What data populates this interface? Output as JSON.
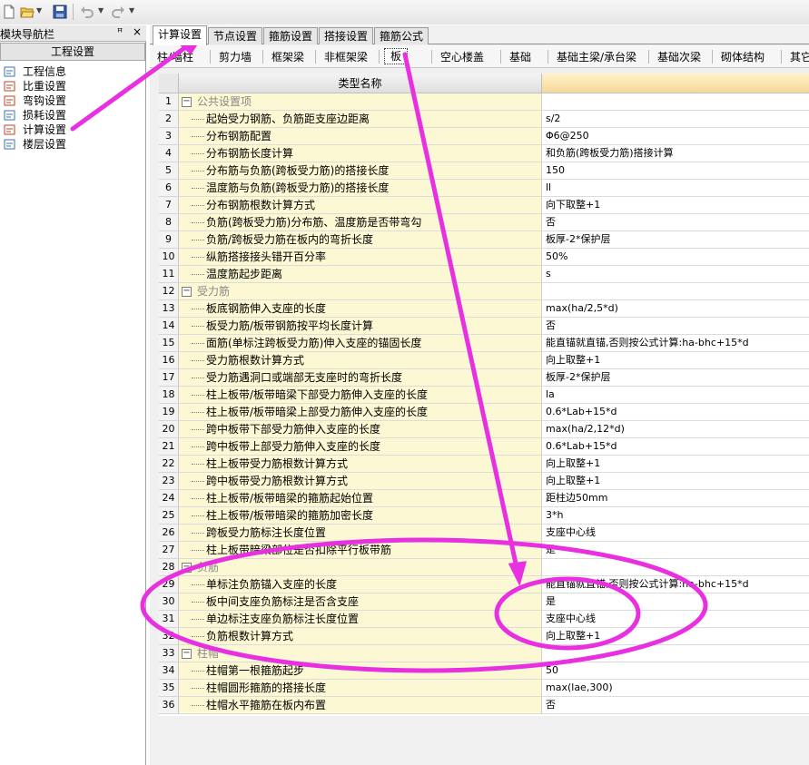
{
  "toolbar": {
    "icons": [
      "new-file-icon",
      "open-folder-icon",
      "save-icon",
      "undo-icon",
      "redo-icon"
    ]
  },
  "nav": {
    "title": "模块导航栏",
    "pin": "ꟸ",
    "close": "×",
    "section": "工程设置",
    "items": [
      {
        "label": "工程信息",
        "icon": "project-info-icon",
        "color": "#3a6fb0"
      },
      {
        "label": "比重设置",
        "icon": "weight-settings-icon",
        "color": "#c04020"
      },
      {
        "label": "弯钩设置",
        "icon": "hook-settings-icon",
        "color": "#c04020"
      },
      {
        "label": "损耗设置",
        "icon": "loss-settings-icon",
        "color": "#3a6fb0"
      },
      {
        "label": "计算设置",
        "icon": "calc-settings-icon",
        "color": "#c04020"
      },
      {
        "label": "楼层设置",
        "icon": "floor-settings-icon",
        "color": "#3a6fb0"
      }
    ]
  },
  "tabs": [
    "计算设置",
    "节点设置",
    "箍筋设置",
    "搭接设置",
    "箍筋公式"
  ],
  "subtabs": [
    "柱/墙柱",
    "剪力墙",
    "框架梁",
    "非框架梁",
    "板",
    "空心楼盖",
    "基础",
    "基础主梁/承台梁",
    "基础次梁",
    "砌体结构",
    "其它"
  ],
  "grid": {
    "header_name": "类型名称",
    "rows": [
      {
        "n": "1",
        "group": true,
        "name": "公共设置项",
        "value": ""
      },
      {
        "n": "2",
        "name": "起始受力钢筋、负筋距支座边距离",
        "value": "s/2"
      },
      {
        "n": "3",
        "name": "分布钢筋配置",
        "value": "Φ6@250"
      },
      {
        "n": "4",
        "name": "分布钢筋长度计算",
        "value": "和负筋(跨板受力筋)搭接计算"
      },
      {
        "n": "5",
        "name": "分布筋与负筋(跨板受力筋)的搭接长度",
        "value": "150"
      },
      {
        "n": "6",
        "name": "温度筋与负筋(跨板受力筋)的搭接长度",
        "value": "ll"
      },
      {
        "n": "7",
        "name": "分布钢筋根数计算方式",
        "value": "向下取整+1"
      },
      {
        "n": "8",
        "name": "负筋(跨板受力筋)分布筋、温度筋是否带弯勾",
        "value": "否"
      },
      {
        "n": "9",
        "name": "负筋/跨板受力筋在板内的弯折长度",
        "value": "板厚-2*保护层"
      },
      {
        "n": "10",
        "name": "纵筋搭接接头错开百分率",
        "value": "50%"
      },
      {
        "n": "11",
        "name": "温度筋起步距离",
        "value": "s"
      },
      {
        "n": "12",
        "group": true,
        "name": "受力筋",
        "value": ""
      },
      {
        "n": "13",
        "name": "板底钢筋伸入支座的长度",
        "value": "max(ha/2,5*d)"
      },
      {
        "n": "14",
        "name": "板受力筋/板带钢筋按平均长度计算",
        "value": "否"
      },
      {
        "n": "15",
        "name": "面筋(单标注跨板受力筋)伸入支座的锚固长度",
        "value": "能直锚就直锚,否则按公式计算:ha-bhc+15*d"
      },
      {
        "n": "16",
        "name": "受力筋根数计算方式",
        "value": "向上取整+1"
      },
      {
        "n": "17",
        "name": "受力筋遇洞口或端部无支座时的弯折长度",
        "value": "板厚-2*保护层"
      },
      {
        "n": "18",
        "name": "柱上板带/板带暗梁下部受力筋伸入支座的长度",
        "value": "la"
      },
      {
        "n": "19",
        "name": "柱上板带/板带暗梁上部受力筋伸入支座的长度",
        "value": "0.6*Lab+15*d"
      },
      {
        "n": "20",
        "name": "跨中板带下部受力筋伸入支座的长度",
        "value": "max(ha/2,12*d)"
      },
      {
        "n": "21",
        "name": "跨中板带上部受力筋伸入支座的长度",
        "value": "0.6*Lab+15*d"
      },
      {
        "n": "22",
        "name": "柱上板带受力筋根数计算方式",
        "value": "向上取整+1"
      },
      {
        "n": "23",
        "name": "跨中板带受力筋根数计算方式",
        "value": "向上取整+1"
      },
      {
        "n": "24",
        "name": "柱上板带/板带暗梁的箍筋起始位置",
        "value": "距柱边50mm"
      },
      {
        "n": "25",
        "name": "柱上板带/板带暗梁的箍筋加密长度",
        "value": "3*h"
      },
      {
        "n": "26",
        "name": "跨板受力筋标注长度位置",
        "value": "支座中心线"
      },
      {
        "n": "27",
        "name": "柱上板带暗梁部位是否扣除平行板带筋",
        "value": "是"
      },
      {
        "n": "28",
        "group": true,
        "name": "负筋",
        "value": ""
      },
      {
        "n": "29",
        "name": "单标注负筋锚入支座的长度",
        "value": "能直锚就直锚,否则按公式计算:ha-bhc+15*d"
      },
      {
        "n": "30",
        "name": "板中间支座负筋标注是否含支座",
        "value": "是"
      },
      {
        "n": "31",
        "name": "单边标注支座负筋标注长度位置",
        "value": "支座中心线"
      },
      {
        "n": "32",
        "name": "负筋根数计算方式",
        "value": "向上取整+1"
      },
      {
        "n": "33",
        "group": true,
        "name": "柱帽",
        "value": ""
      },
      {
        "n": "34",
        "name": "柱帽第一根箍筋起步",
        "value": "50"
      },
      {
        "n": "35",
        "name": "柱帽圆形箍筋的搭接长度",
        "value": "max(lae,300)"
      },
      {
        "n": "36",
        "name": "柱帽水平箍筋在板内布置",
        "value": "否"
      }
    ]
  },
  "annotation_color": "#e830e0"
}
